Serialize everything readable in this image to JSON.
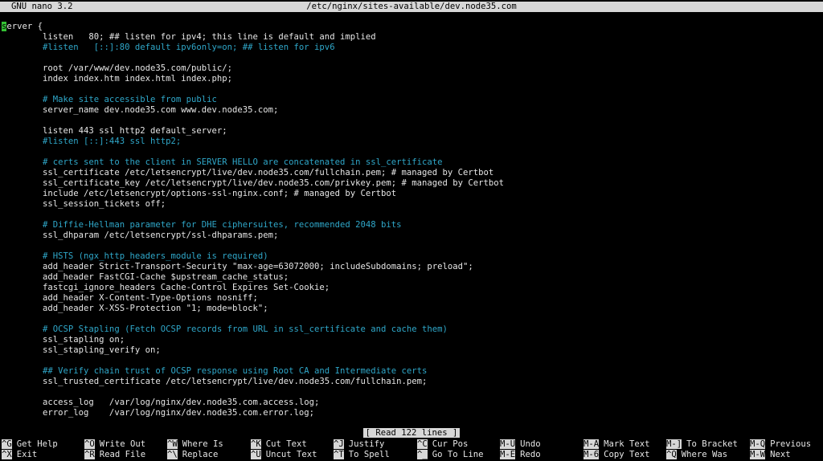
{
  "titlebar": {
    "app_version": "GNU nano 3.2",
    "filename": "/etc/nginx/sites-available/dev.node35.com"
  },
  "editor": {
    "cursor_char": "s",
    "lines": [
      {
        "text": "erver {",
        "type": "code",
        "cursor": true
      },
      {
        "text": "        listen   80; ## listen for ipv4; this line is default and implied",
        "type": "code"
      },
      {
        "text": "        #listen   [::]:80 default ipv6only=on; ## listen for ipv6",
        "type": "comment"
      },
      {
        "text": "",
        "type": "code"
      },
      {
        "text": "        root /var/www/dev.node35.com/public/;",
        "type": "code"
      },
      {
        "text": "        index index.htm index.html index.php;",
        "type": "code"
      },
      {
        "text": "",
        "type": "code"
      },
      {
        "text": "        # Make site accessible from public",
        "type": "comment"
      },
      {
        "text": "        server_name dev.node35.com www.dev.node35.com;",
        "type": "code"
      },
      {
        "text": "",
        "type": "code"
      },
      {
        "text": "        listen 443 ssl http2 default_server;",
        "type": "code"
      },
      {
        "text": "        #listen [::]:443 ssl http2;",
        "type": "comment"
      },
      {
        "text": "",
        "type": "code"
      },
      {
        "text": "        # certs sent to the client in SERVER HELLO are concatenated in ssl_certificate",
        "type": "comment"
      },
      {
        "text": "        ssl_certificate /etc/letsencrypt/live/dev.node35.com/fullchain.pem; # managed by Certbot",
        "type": "code"
      },
      {
        "text": "        ssl_certificate_key /etc/letsencrypt/live/dev.node35.com/privkey.pem; # managed by Certbot",
        "type": "code"
      },
      {
        "text": "        include /etc/letsencrypt/options-ssl-nginx.conf; # managed by Certbot",
        "type": "code"
      },
      {
        "text": "        ssl_session_tickets off;",
        "type": "code"
      },
      {
        "text": "",
        "type": "code"
      },
      {
        "text": "        # Diffie-Hellman parameter for DHE ciphersuites, recommended 2048 bits",
        "type": "comment"
      },
      {
        "text": "        ssl_dhparam /etc/letsencrypt/ssl-dhparams.pem;",
        "type": "code"
      },
      {
        "text": "",
        "type": "code"
      },
      {
        "text": "        # HSTS (ngx_http_headers_module is required)",
        "type": "comment"
      },
      {
        "text": "        add_header Strict-Transport-Security \"max-age=63072000; includeSubdomains; preload\";",
        "type": "code"
      },
      {
        "text": "        add_header FastCGI-Cache $upstream_cache_status;",
        "type": "code"
      },
      {
        "text": "        fastcgi_ignore_headers Cache-Control Expires Set-Cookie;",
        "type": "code"
      },
      {
        "text": "        add_header X-Content-Type-Options nosniff;",
        "type": "code"
      },
      {
        "text": "        add_header X-XSS-Protection \"1; mode=block\";",
        "type": "code"
      },
      {
        "text": "",
        "type": "code"
      },
      {
        "text": "        # OCSP Stapling (Fetch OCSP records from URL in ssl_certificate and cache them)",
        "type": "comment"
      },
      {
        "text": "        ssl_stapling on;",
        "type": "code"
      },
      {
        "text": "        ssl_stapling_verify on;",
        "type": "code"
      },
      {
        "text": "",
        "type": "code"
      },
      {
        "text": "        ## Verify chain trust of OCSP response using Root CA and Intermediate certs",
        "type": "comment"
      },
      {
        "text": "        ssl_trusted_certificate /etc/letsencrypt/live/dev.node35.com/fullchain.pem;",
        "type": "code"
      },
      {
        "text": "",
        "type": "code"
      },
      {
        "text": "        access_log   /var/log/nginx/dev.node35.com.access.log;",
        "type": "code"
      },
      {
        "text": "        error_log    /var/log/nginx/dev.node35.com.error.log;",
        "type": "code"
      }
    ]
  },
  "status": {
    "message": "[ Read 122 lines ]"
  },
  "shortcuts": [
    {
      "key": "^G",
      "label": "Get Help"
    },
    {
      "key": "^X",
      "label": "Exit"
    },
    {
      "key": "^O",
      "label": "Write Out"
    },
    {
      "key": "^R",
      "label": "Read File"
    },
    {
      "key": "^W",
      "label": "Where Is"
    },
    {
      "key": "^\\",
      "label": "Replace"
    },
    {
      "key": "^K",
      "label": "Cut Text"
    },
    {
      "key": "^U",
      "label": "Uncut Text"
    },
    {
      "key": "^J",
      "label": "Justify"
    },
    {
      "key": "^T",
      "label": "To Spell"
    },
    {
      "key": "^C",
      "label": "Cur Pos"
    },
    {
      "key": "^_",
      "label": "Go To Line"
    },
    {
      "key": "M-U",
      "label": "Undo"
    },
    {
      "key": "M-E",
      "label": "Redo"
    },
    {
      "key": "M-A",
      "label": "Mark Text"
    },
    {
      "key": "M-6",
      "label": "Copy Text"
    },
    {
      "key": "M-]",
      "label": "To Bracket"
    },
    {
      "key": "^Q",
      "label": "Where Was"
    },
    {
      "key": "M-Q",
      "label": "Previous"
    },
    {
      "key": "M-W",
      "label": "Next"
    }
  ],
  "colors": {
    "background": "#000000",
    "text": "#e6e6e6",
    "comment": "#2fa7c9",
    "bar": "#d7d7d7",
    "cursor": "#34c234"
  }
}
